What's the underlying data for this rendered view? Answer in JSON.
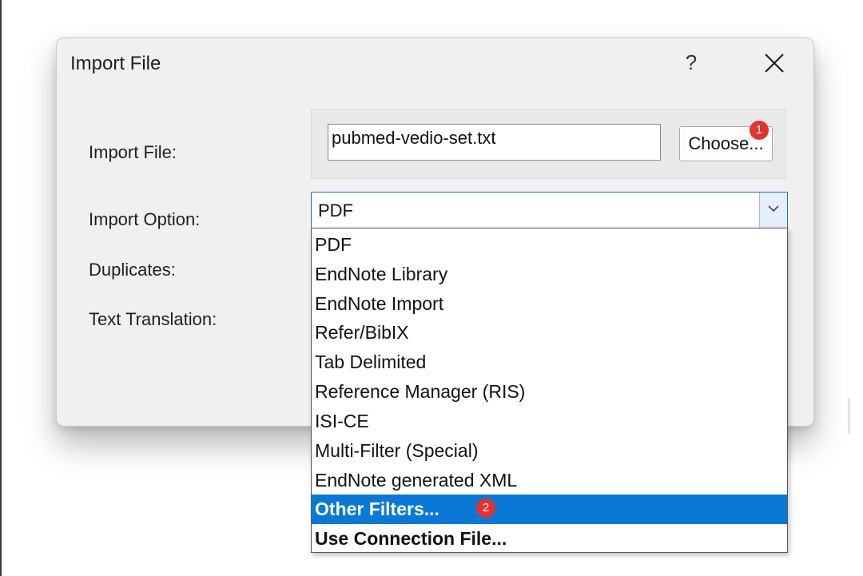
{
  "dialog": {
    "title": "Import File",
    "help_label": "?",
    "close_icon": "close-icon"
  },
  "form": {
    "import_file_label": "Import File:",
    "import_option_label": "Import Option:",
    "duplicates_label": "Duplicates:",
    "text_translation_label": "Text Translation:",
    "file_value": "pubmed-vedio-set.txt",
    "choose_label": "Choose...",
    "import_option_value": "PDF"
  },
  "badges": {
    "choose_badge": "1",
    "other_filters_badge": "2",
    "color": "#e5322d"
  },
  "dropdown": {
    "items": [
      "PDF",
      "EndNote Library",
      "EndNote Import",
      "Refer/BibIX",
      "Tab Delimited",
      "Reference Manager (RIS)",
      "ISI-CE",
      "Multi-Filter (Special)",
      "EndNote generated XML",
      "Other Filters...",
      "Use Connection File..."
    ],
    "selected_index": 9,
    "highlight_color": "#0a78d7"
  }
}
